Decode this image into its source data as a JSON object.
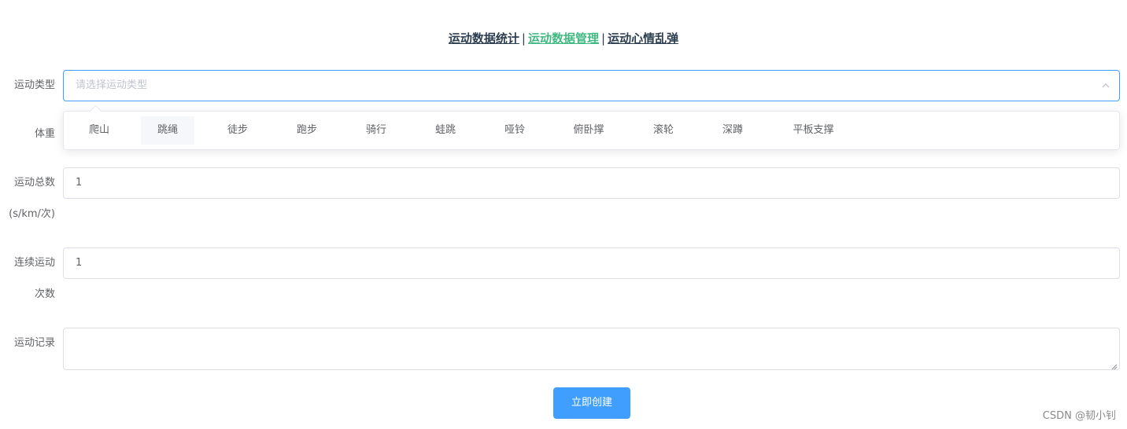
{
  "nav": {
    "links": [
      "运动数据统计",
      "运动数据管理",
      "运动心情乱弹"
    ],
    "separator": "|",
    "active_index": 1,
    "active_color": "#42b983"
  },
  "form": {
    "type_label": "运动类型",
    "type_placeholder": "请选择运动类型",
    "weight_label": "体重",
    "total_label_line1": "运动总数",
    "total_label_line2": "(s/km/次)",
    "total_value": "1",
    "continuous_label_line1": "连续运动",
    "continuous_label_line2": "次数",
    "continuous_value": "1",
    "record_label": "运动记录",
    "record_value": "",
    "submit_label": "立即创建"
  },
  "dropdown": {
    "options": [
      "爬山",
      "跳绳",
      "徒步",
      "跑步",
      "骑行",
      "蛙跳",
      "哑铃",
      "俯卧撑",
      "滚轮",
      "深蹲",
      "平板支撑"
    ],
    "hovered": "跳绳"
  },
  "colors": {
    "primary": "#409eff",
    "hover_bg": "#f5f7fa"
  },
  "icons": {
    "select_arrow": "chevron-up-icon",
    "textarea_resize": "resize-handle-icon"
  },
  "watermark": "CSDN @韧小钊"
}
